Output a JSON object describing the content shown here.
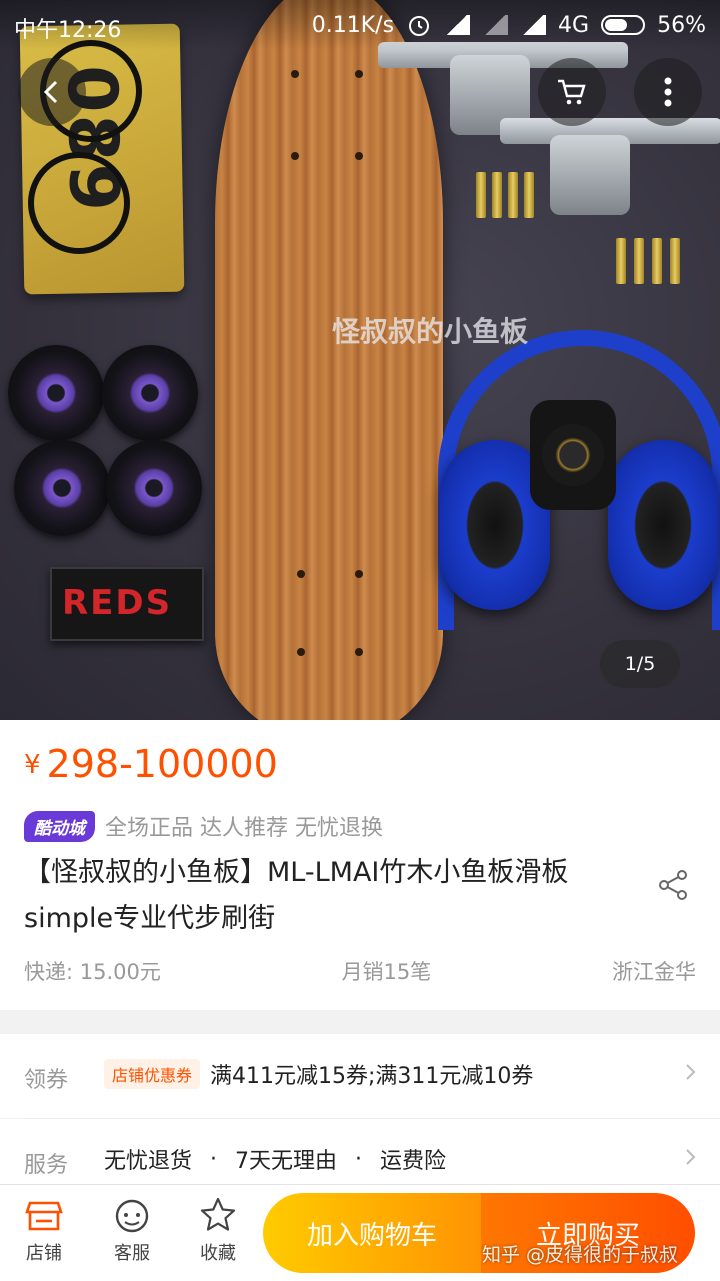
{
  "status_bar": {
    "time": "中午12:26",
    "speed": "0.11K/s",
    "network": "4G",
    "battery": "56%"
  },
  "hero": {
    "watermark": "怪叔叔的小鱼板",
    "page_indicator": "1/5",
    "plate_number": "089",
    "bearings_brand": "REDS"
  },
  "product": {
    "currency": "¥",
    "price_range": "298-100000",
    "badge": "酷动城",
    "promises": "全场正品 达人推荐 无忧退换",
    "title": "【怪叔叔的小鱼板】ML-LMAI竹木小鱼板滑板simple专业代步刷街",
    "shipping": "快递: 15.00元",
    "monthly_sales": "月销15笔",
    "location": "浙江金华"
  },
  "coupon": {
    "label": "领券",
    "tag": "店铺优惠券",
    "text": "满411元减15券;满311元减10券"
  },
  "service": {
    "label": "服务",
    "items": [
      "无忧退货",
      "7天无理由",
      "运费险"
    ],
    "separator": "·"
  },
  "bottom": {
    "shop": "店铺",
    "service": "客服",
    "favorite": "收藏",
    "add_to_cart": "加入购物车",
    "buy_now": "立即购买"
  },
  "overlay_watermark": "知乎 @皮得很的于叔叔",
  "colors": {
    "price": "#ff5000",
    "badge": "#6a3ad8",
    "cart_gradient": [
      "#ffcb00",
      "#ff9402"
    ],
    "buy_gradient": [
      "#ff7700",
      "#ff4e00"
    ]
  }
}
